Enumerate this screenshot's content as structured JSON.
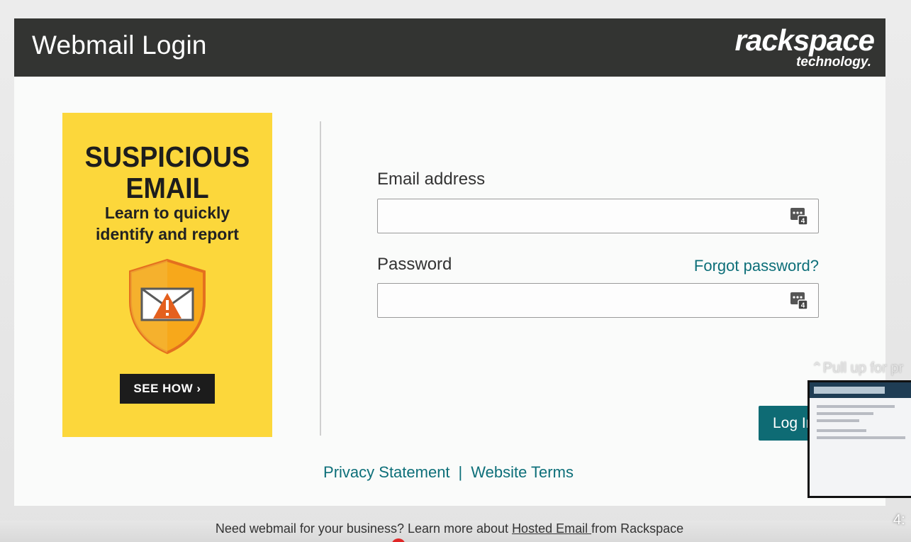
{
  "header": {
    "title": "Webmail Login",
    "brand_name": "rackspace",
    "brand_sub": "technology."
  },
  "ad": {
    "headline_line1": "SUSPICIOUS",
    "headline_line2": "EMAIL",
    "sub_line1": "Learn to quickly",
    "sub_line2": "identify and report",
    "button_label": "SEE HOW ›",
    "background_color": "#fcd73b",
    "icon": "shield-envelope-warning-icon"
  },
  "form": {
    "email_label": "Email address",
    "email_value": "",
    "password_label": "Password",
    "password_value": "",
    "forgot_label": "Forgot password?",
    "login_label": "Log In",
    "field_icon": "password-manager-icon"
  },
  "footer": {
    "privacy_label": "Privacy Statement",
    "separator": "|",
    "terms_label": "Website Terms"
  },
  "bottom": {
    "text_before": "Need webmail for your business? Learn more about ",
    "link_label": "Hosted Email ",
    "text_after": "from Rackspace"
  },
  "overlay": {
    "pull_up_text": "⌃Pull up for pr",
    "time_text": "4:"
  },
  "colors": {
    "header_bg": "#333432",
    "accent_teal": "#0e6b74",
    "link_teal": "#0d6f79"
  }
}
